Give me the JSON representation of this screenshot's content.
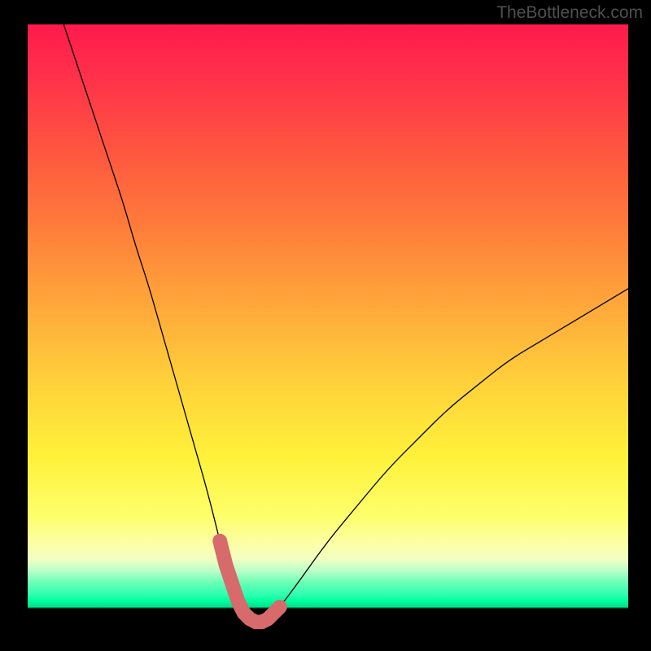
{
  "watermark": "TheBottleneck.com",
  "colors": {
    "background": "#000000",
    "curve": "#000000",
    "marker": "#d76a6a",
    "gradient_top": "#ff1a4b",
    "gradient_mid": "#fff13a",
    "gradient_green": "#00ff9e"
  },
  "chart_data": {
    "type": "line",
    "title": "",
    "xlabel": "",
    "ylabel": "",
    "xlim": [
      0,
      100
    ],
    "ylim": [
      0,
      100
    ],
    "series": [
      {
        "name": "bottleneck-curve",
        "x": [
          6,
          8,
          10,
          12,
          14,
          16,
          18,
          20,
          22,
          24,
          26,
          28,
          30,
          32,
          33,
          34,
          35,
          36,
          37,
          38,
          39,
          40,
          42,
          45,
          50,
          55,
          60,
          65,
          70,
          75,
          80,
          85,
          90,
          95,
          100
        ],
        "values": [
          100,
          94,
          88,
          82,
          76,
          70,
          63,
          57,
          50,
          43,
          36,
          29,
          22,
          14,
          10,
          7,
          4,
          2,
          1,
          0.5,
          0.5,
          1,
          3,
          7,
          14,
          20,
          26,
          31,
          36,
          40,
          44,
          47,
          50,
          53,
          56
        ]
      }
    ],
    "markers": {
      "name": "highlight-points",
      "x": [
        32,
        33,
        34,
        35,
        36,
        37,
        38,
        39,
        40,
        41,
        42
      ],
      "values": [
        14,
        10,
        7,
        4,
        2,
        1,
        0.5,
        0.5,
        1,
        2,
        3
      ]
    }
  }
}
